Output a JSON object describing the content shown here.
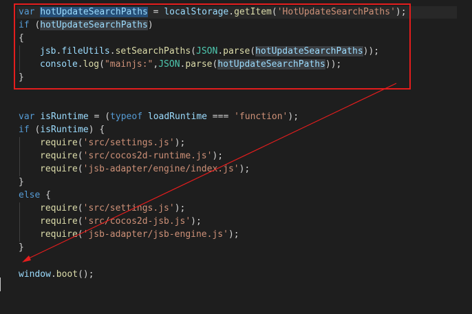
{
  "code": {
    "line1": {
      "kw": "var",
      "var": "hotUpdateSearchPaths",
      "eq": " = ",
      "obj": "localStorage",
      "dot": ".",
      "method": "getItem",
      "open": "(",
      "arg": "'HotUpdateSearchPaths'",
      "close": ");"
    },
    "line2": {
      "kw": "if",
      "open": " (",
      "var": "hotUpdateSearchPaths",
      "close": ")"
    },
    "line3": {
      "text": "{"
    },
    "line4": {
      "obj": "jsb",
      "dot1": ".",
      "prop": "fileUtils",
      "dot2": ".",
      "method": "setSearchPaths",
      "open": "(",
      "json": "JSON",
      "dot3": ".",
      "parse": "parse",
      "open2": "(",
      "var": "hotUpdateSearchPaths",
      "close": "));"
    },
    "line5": {
      "obj": "console",
      "dot1": ".",
      "method": "log",
      "open": "(",
      "str": "\"mainjs:\"",
      "comma": ",",
      "json": "JSON",
      "dot2": ".",
      "parse": "parse",
      "open2": "(",
      "var": "hotUpdateSearchPaths",
      "close": "));"
    },
    "line6": {
      "text": "}"
    },
    "line7": {
      "kw": "var",
      "var": "isRuntime",
      "eq": " = (",
      "kw2": "typeof",
      "sp": " ",
      "id": "loadRuntime",
      "op": " === ",
      "str": "'function'",
      "close": ");"
    },
    "line8": {
      "kw": "if",
      "open": " (",
      "var": "isRuntime",
      "close": ") {"
    },
    "line9": {
      "fn": "require",
      "open": "(",
      "str": "'src/settings.js'",
      "close": ");"
    },
    "line10": {
      "fn": "require",
      "open": "(",
      "str": "'src/cocos2d-runtime.js'",
      "close": ");"
    },
    "line11": {
      "fn": "require",
      "open": "(",
      "str": "'jsb-adapter/engine/index.js'",
      "close": ");"
    },
    "line12": {
      "text": "}"
    },
    "line13": {
      "kw": "else",
      "rest": " {"
    },
    "line14": {
      "fn": "require",
      "open": "(",
      "str": "'src/settings.js'",
      "close": ");"
    },
    "line15": {
      "fn": "require",
      "open": "(",
      "str": "'src/cocos2d-jsb.js'",
      "close": ");"
    },
    "line16": {
      "fn": "require",
      "open": "(",
      "str": "'jsb-adapter/jsb-engine.js'",
      "close": ");"
    },
    "line17": {
      "text": "}"
    },
    "line18": {
      "id": "window",
      "dot": ".",
      "fn": "boot",
      "close": "();"
    }
  },
  "annotation": {
    "box_color": "#e51d1d",
    "arrow_color": "#e51d1d"
  },
  "colors": {
    "background": "#1e1e1e",
    "keyword": "#569cd6",
    "string": "#ce9178",
    "identifier": "#9cdcfe",
    "function": "#dcdcaa",
    "class": "#4ec9b0",
    "selection": "#264f78"
  }
}
